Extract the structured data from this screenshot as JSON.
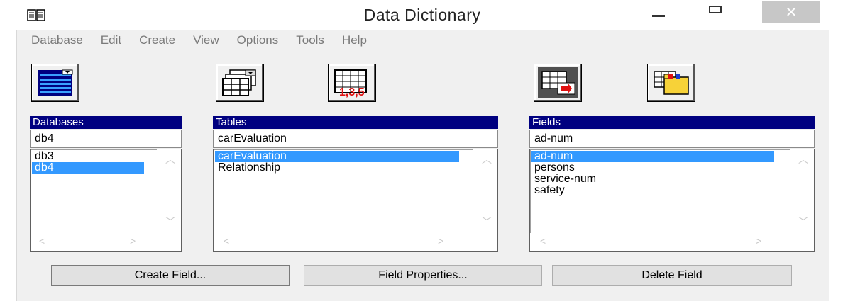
{
  "window": {
    "title": "Data Dictionary"
  },
  "menu": [
    "Database",
    "Edit",
    "Create",
    "View",
    "Options",
    "Tools",
    "Help"
  ],
  "toolbar": [
    {
      "icon": "database-icon"
    },
    {
      "icon": "table-select-icon"
    },
    {
      "icon": "table-numbered-icon"
    },
    {
      "icon": "table-relation-icon"
    },
    {
      "icon": "folders-table-icon"
    }
  ],
  "databases": {
    "label": "Databases",
    "value": "db4",
    "items": [
      "db3",
      "db4"
    ],
    "selected": "db4"
  },
  "tables": {
    "label": "Tables",
    "value": "carEvaluation",
    "items": [
      "carEvaluation",
      "Relationship"
    ],
    "selected": "carEvaluation"
  },
  "fields": {
    "label": "Fields",
    "value": "ad-num",
    "items": [
      "ad-num",
      "persons",
      "service-num",
      "safety"
    ],
    "selected": "ad-num"
  },
  "buttons": {
    "create_field": "Create Field...",
    "field_properties": "Field Properties...",
    "delete_field": "Delete Field"
  },
  "colors": {
    "header": "#000080",
    "selection": "#3399ff",
    "face": "#f0f0f0"
  }
}
